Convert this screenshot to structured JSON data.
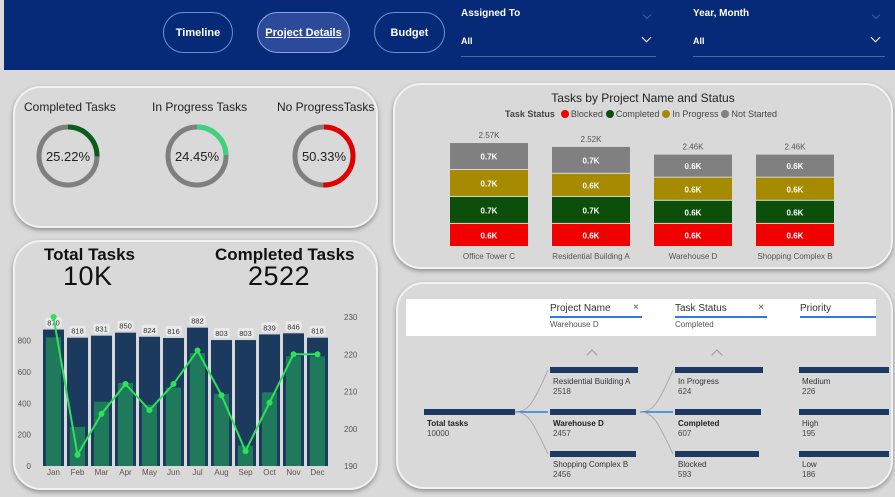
{
  "nav": {
    "timeline": "Timeline",
    "project_details": "Project Details",
    "budget": "Budget"
  },
  "slicers": {
    "assigned_to": {
      "label": "Assigned To",
      "value": "All"
    },
    "year_month": {
      "label": "Year, Month",
      "value": "All"
    }
  },
  "kpis": [
    {
      "title": "Completed Tasks",
      "value": "25.22%",
      "pct": 0.2522,
      "color": "#0b5d1e"
    },
    {
      "title": "In Progress Tasks",
      "value": "24.45%",
      "pct": 0.2445,
      "color": "#3ad47a"
    },
    {
      "title": "No ProgressTasks",
      "value": "50.33%",
      "pct": 0.5033,
      "color": "#e00000"
    }
  ],
  "totals": {
    "total_label": "Total Tasks",
    "total_value": "10K",
    "completed_label": "Completed Tasks",
    "completed_value": "2522"
  },
  "colors": {
    "header_bg": "#062a77",
    "bar_dark": "#1b3a5e",
    "bar_green": "#1e7a5a",
    "line_green": "#2ee05a",
    "blocked": "#f00000",
    "completed": "#0b4f0b",
    "in_progress": "#a68a00",
    "not_started": "#808080"
  },
  "chart_data": [
    {
      "type": "bar",
      "title": "",
      "categories": [
        "Jan",
        "Feb",
        "Mar",
        "Apr",
        "May",
        "Jun",
        "Jul",
        "Aug",
        "Sep",
        "Oct",
        "Nov",
        "Dec"
      ],
      "series": [
        {
          "values": [
            870,
            818,
            831,
            850,
            824,
            816,
            882,
            803,
            803,
            839,
            846,
            818
          ]
        },
        {
          "values": [
            820,
            250,
            410,
            530,
            390,
            500,
            720,
            460,
            130,
            470,
            700,
            700
          ]
        },
        {
          "values": [
            230,
            193,
            204,
            212,
            205,
            212,
            221,
            209,
            194,
            207,
            220,
            220
          ]
        }
      ],
      "ylim": [
        0,
        950
      ],
      "yticks": [
        "0",
        "200",
        "400",
        "600",
        "800"
      ],
      "y2lim": [
        190,
        230
      ],
      "y2ticks": [
        "190",
        "200",
        "210",
        "220",
        "230"
      ]
    },
    {
      "type": "bar",
      "title": "Tasks by Project Name and Status",
      "legend_title": "Task Status",
      "legend_position": "top",
      "categories": [
        "Office Tower C",
        "Residential Building A",
        "Warehouse D",
        "Shopping Complex B"
      ],
      "totals": [
        "2.57K",
        "2.52K",
        "2.46K",
        "2.46K"
      ],
      "series": [
        {
          "name": "Blocked",
          "values": [
            0.6,
            0.6,
            0.6,
            0.6
          ],
          "labels": [
            "0.6K",
            "0.6K",
            "0.6K",
            "0.6K"
          ]
        },
        {
          "name": "Completed",
          "values": [
            0.7,
            0.7,
            0.6,
            0.6
          ],
          "labels": [
            "0.7K",
            "0.7K",
            "0.6K",
            "0.6K"
          ]
        },
        {
          "name": "In Progress",
          "values": [
            0.7,
            0.6,
            0.6,
            0.6
          ],
          "labels": [
            "0.7K",
            "0.6K",
            "0.6K",
            "0.6K"
          ]
        },
        {
          "name": "Not Started",
          "values": [
            0.7,
            0.7,
            0.6,
            0.6
          ],
          "labels": [
            "0.7K",
            "0.7K",
            "0.6K",
            "0.6K"
          ]
        }
      ]
    }
  ],
  "decomposition": {
    "columns": [
      {
        "title": "",
        "sub": ""
      },
      {
        "title": "Project Name",
        "sub": "Warehouse D"
      },
      {
        "title": "Task Status",
        "sub": "Completed"
      },
      {
        "title": "Priority",
        "sub": ""
      }
    ],
    "root": {
      "name": "Total tasks",
      "value": "10000"
    },
    "level1": [
      {
        "name": "Residential Building A",
        "value": "2518"
      },
      {
        "name": "Warehouse D",
        "value": "2457"
      },
      {
        "name": "Shopping Complex B",
        "value": "2456"
      }
    ],
    "level2": [
      {
        "name": "In Progress",
        "value": "624"
      },
      {
        "name": "Completed",
        "value": "607"
      },
      {
        "name": "Blocked",
        "value": "593"
      }
    ],
    "level3": [
      {
        "name": "Medium",
        "value": "226"
      },
      {
        "name": "High",
        "value": "195"
      },
      {
        "name": "Low",
        "value": "186"
      }
    ],
    "close_symbol": "×"
  }
}
